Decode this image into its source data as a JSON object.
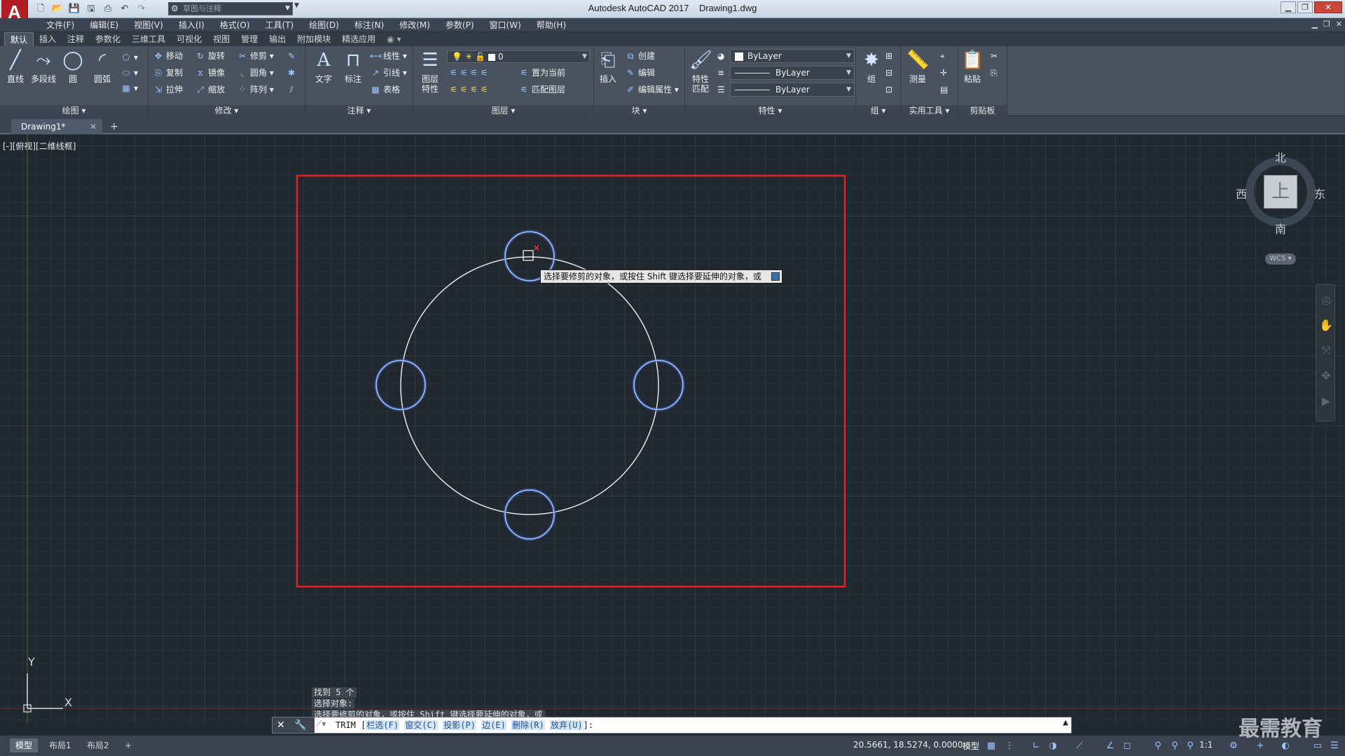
{
  "titlebar": {
    "app_title": "Autodesk AutoCAD 2017",
    "doc_title": "Drawing1.dwg",
    "workspace": "草图与注释",
    "app_logo": "A"
  },
  "menu": {
    "items": [
      "文件(F)",
      "编辑(E)",
      "视图(V)",
      "插入(I)",
      "格式(O)",
      "工具(T)",
      "绘图(D)",
      "标注(N)",
      "修改(M)",
      "参数(P)",
      "窗口(W)",
      "帮助(H)"
    ]
  },
  "ribbon_tabs": [
    "默认",
    "插入",
    "注释",
    "参数化",
    "三维工具",
    "可视化",
    "视图",
    "管理",
    "输出",
    "附加模块",
    "精选应用"
  ],
  "ribbon": {
    "draw": {
      "title": "绘图 ▾",
      "line": "直线",
      "polyline": "多段线",
      "circle": "圆",
      "arc": "圆弧"
    },
    "modify": {
      "title": "修改 ▾",
      "move": "移动",
      "rotate": "旋转",
      "trim": "修剪",
      "copy": "复制",
      "mirror": "镜像",
      "fillet": "圆角",
      "stretch": "拉伸",
      "scale": "缩放",
      "array": "阵列"
    },
    "annotation": {
      "title": "注释 ▾",
      "text": "文字",
      "dimension": "标注",
      "linear": "线性",
      "leader": "引线",
      "table": "表格"
    },
    "layers": {
      "title": "图层 ▾",
      "properties": "图层\n特性",
      "current_layer": "0",
      "set_current": "置为当前",
      "match": "匹配图层"
    },
    "block": {
      "title": "块 ▾",
      "insert": "插入",
      "create": "创建",
      "edit": "编辑",
      "edit_attr": "编辑属性"
    },
    "properties": {
      "title": "特性 ▾",
      "match": "特性\n匹配",
      "color": "ByLayer",
      "linetype": "ByLayer",
      "lineweight": "ByLayer"
    },
    "groups": {
      "title": "组 ▾",
      "group": "组"
    },
    "utilities": {
      "title": "实用工具 ▾",
      "measure": "测量"
    },
    "clipboard": {
      "title": "剪贴板",
      "paste": "粘贴"
    }
  },
  "doc_tab": {
    "label": "Drawing1*"
  },
  "viewport_label": "[-][俯视][二维线框]",
  "tooltip": "选择要修剪的对象，或按住 Shift 键选择要延伸的对象，或",
  "viewcube": {
    "face": "上",
    "north": "北",
    "south": "南",
    "east": "东",
    "west": "西",
    "wcs": "WCS"
  },
  "ucs": {
    "x": "X",
    "y": "Y"
  },
  "command_history": [
    "找到 5 个",
    "选择对象:",
    "选择要修剪的对象，或按住 Shift 键选择要延伸的对象，或"
  ],
  "command_line": {
    "command": "TRIM",
    "opt_open": "[",
    "options": [
      "栏选(F)",
      "窗交(C)",
      "投影(P)",
      "边(E)",
      "删除(R)",
      "放弃(U)"
    ],
    "opt_close": "]:"
  },
  "status": {
    "layouts": [
      "模型",
      "布局1",
      "布局2"
    ],
    "coords": "20.5661, 18.5274, 0.0000",
    "space": "模型",
    "scale": "1:1"
  },
  "watermark": "最需教育",
  "colors": {
    "frame_red": "#e52222",
    "selected_blue": "#6f9fff",
    "main_circle": "#e8e8e8",
    "canvas_bg": "#212830"
  }
}
